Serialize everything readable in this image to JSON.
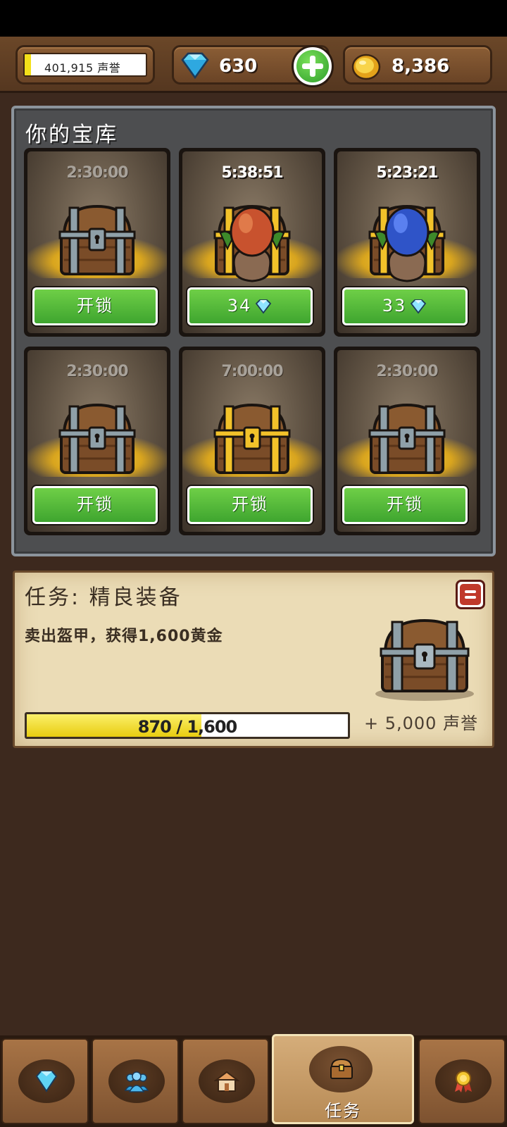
{
  "resources": {
    "reputation_label": "401,915 声誉",
    "reputation_fill": 0.05,
    "gems": "630",
    "gold": "8,386",
    "add_icon": "plus-icon"
  },
  "treasury": {
    "title": "你的宝库",
    "chests": [
      {
        "timer": "2:30:00",
        "kind": "wooden",
        "button": "开锁",
        "button_gem": false
      },
      {
        "timer": "5:38:51",
        "kind": "gold-red-bag",
        "button": "34",
        "button_gem": true
      },
      {
        "timer": "5:23:21",
        "kind": "gold-blue-bag",
        "button": "33",
        "button_gem": true
      },
      {
        "timer": "2:30:00",
        "kind": "wooden",
        "button": "开锁",
        "button_gem": false
      },
      {
        "timer": "7:00:00",
        "kind": "gold",
        "button": "开锁",
        "button_gem": false
      },
      {
        "timer": "2:30:00",
        "kind": "wooden",
        "button": "开锁",
        "button_gem": false
      }
    ]
  },
  "quest": {
    "title": "任务: 精良装备",
    "description": "卖出盔甲，获得1,600黄金",
    "progress_text": "870 / 1,600",
    "progress_value": 870,
    "progress_max": 1600,
    "reward": "+ 5,000 声誉"
  },
  "nav": {
    "tabs": [
      {
        "icon": "gem-icon",
        "label": ""
      },
      {
        "icon": "people-icon",
        "label": ""
      },
      {
        "icon": "shop-icon",
        "label": ""
      },
      {
        "icon": "chest-icon",
        "label": "任务"
      },
      {
        "icon": "medal-icon",
        "label": ""
      }
    ],
    "active_index": 3
  },
  "colors": {
    "background": "#3d291e",
    "button_green": "#4fb838",
    "progress_yellow": "#f3e01a",
    "panel_grey": "#4d4e50"
  }
}
